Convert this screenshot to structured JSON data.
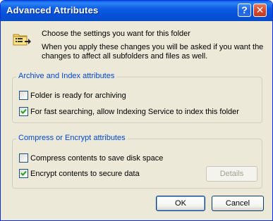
{
  "window": {
    "title": "Advanced Attributes",
    "help_glyph": "?",
    "close_glyph": "✕"
  },
  "intro": {
    "icon": "folder-settings-icon",
    "line1": "Choose the settings you want for this folder",
    "line2": "When you apply these changes you will be asked if you want the changes to affect all subfolders and files as well."
  },
  "archive_group": {
    "legend": "Archive and Index attributes",
    "items": [
      {
        "label": "Folder is ready for archiving",
        "checked": false
      },
      {
        "label": "For fast searching, allow Indexing Service to index this folder",
        "checked": true
      }
    ]
  },
  "compress_group": {
    "legend": "Compress or Encrypt attributes",
    "items": [
      {
        "label": "Compress contents to save disk space",
        "checked": false
      },
      {
        "label": "Encrypt contents to secure data",
        "checked": true
      }
    ],
    "details_label": "Details",
    "details_enabled": false
  },
  "buttons": {
    "ok_label": "OK",
    "cancel_label": "Cancel"
  },
  "colors": {
    "title_bar": "#0a5fe9",
    "dialog_face": "#ece9d8",
    "group_legend": "#0046d5",
    "checkmark": "#21a121"
  }
}
